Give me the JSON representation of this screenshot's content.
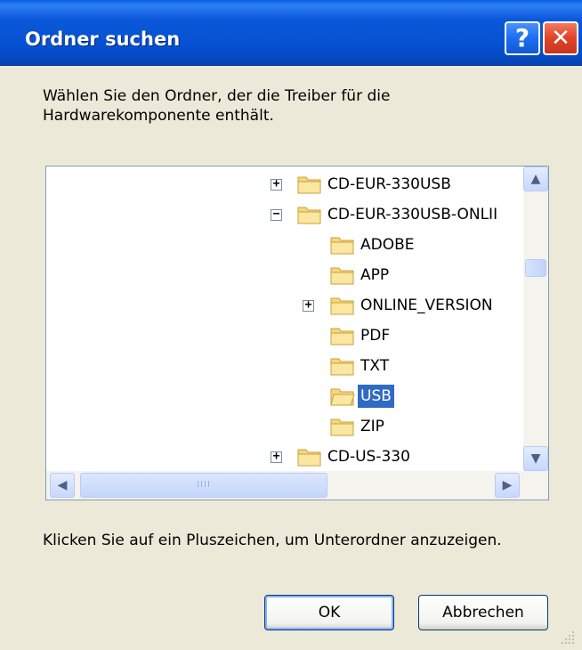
{
  "window": {
    "title": "Ordner suchen",
    "help_label": "?",
    "close_label": "✕"
  },
  "instructions": "Wählen Sie den Ordner, der die Treiber für die Hardwarekomponente enthält.",
  "tree": {
    "items": [
      {
        "label": "CD-EUR-330USB",
        "expander": "+",
        "selected": false
      },
      {
        "label": "CD-EUR-330USB-ONLII",
        "expander": "−",
        "selected": false
      },
      {
        "label": "ADOBE",
        "expander": "",
        "selected": false
      },
      {
        "label": "APP",
        "expander": "",
        "selected": false
      },
      {
        "label": "ONLINE_VERSION",
        "expander": "+",
        "selected": false
      },
      {
        "label": "PDF",
        "expander": "",
        "selected": false
      },
      {
        "label": "TXT",
        "expander": "",
        "selected": false
      },
      {
        "label": "USB",
        "expander": "",
        "selected": true
      },
      {
        "label": "ZIP",
        "expander": "",
        "selected": false
      },
      {
        "label": "CD-US-330",
        "expander": "+",
        "selected": false
      }
    ]
  },
  "scrollbar": {
    "up_icon": "▲",
    "down_icon": "▼",
    "left_icon": "◀",
    "right_icon": "▶",
    "thumb_grip": "IIII"
  },
  "hint": "Klicken Sie auf ein Pluszeichen, um Unterordner anzuzeigen.",
  "buttons": {
    "ok": "OK",
    "cancel": "Abbrechen"
  },
  "colors": {
    "title_bar": "#0551d2",
    "selection": "#316ac5",
    "dialog_bg": "#ece9d8"
  }
}
